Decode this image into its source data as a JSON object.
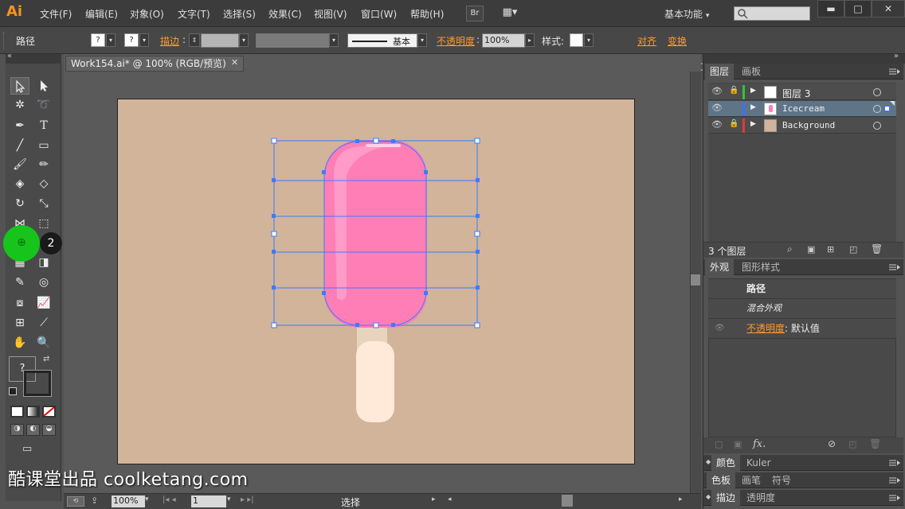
{
  "app": {
    "logo": "Ai",
    "workspace_label": "基本功能",
    "workspace_arrow": "▾"
  },
  "menu": [
    {
      "label": "文件(F)"
    },
    {
      "label": "编辑(E)"
    },
    {
      "label": "对象(O)"
    },
    {
      "label": "文字(T)"
    },
    {
      "label": "选择(S)"
    },
    {
      "label": "效果(C)"
    },
    {
      "label": "视图(V)"
    },
    {
      "label": "窗口(W)"
    },
    {
      "label": "帮助(H)"
    }
  ],
  "menu_buttons": {
    "bridge": "Br",
    "arrange": "▦▾"
  },
  "window_buttons": {
    "minimize": "▬",
    "maximize": "□",
    "close": "✕"
  },
  "control_bar": {
    "object_type": "路径",
    "fill_unknown": "?",
    "stroke_unknown": "?",
    "stroke_label": "描边",
    "stroke_style": "基本",
    "opacity_label": "不透明度",
    "opacity_value": "100%",
    "style_label": "样式",
    "align_label": "对齐",
    "transform_label": "变换"
  },
  "document": {
    "tab_title": "Work154.ai* @ 100% (RGB/预览)",
    "tab_close": "✕"
  },
  "toolbar": {
    "fill_stroke_unknown": "?"
  },
  "status_bar": {
    "zoom": "100%",
    "artboard": "1",
    "status_text": "选择"
  },
  "layers_panel": {
    "tabs": [
      {
        "label": "图层"
      },
      {
        "label": "画板"
      }
    ],
    "layers": [
      {
        "name": "图层 3",
        "color": "#2fc43a",
        "locked": true
      },
      {
        "name": "Icecream",
        "color": "#3d6fff",
        "locked": false
      },
      {
        "name": "Background",
        "color": "#e23a3a",
        "locked": true
      }
    ],
    "count_label": "3 个图层"
  },
  "appearance_panel": {
    "tabs": [
      {
        "label": "外观"
      },
      {
        "label": "图形样式"
      }
    ],
    "title": "路径",
    "mixed": "混合外观",
    "opacity_label": "不透明度",
    "opacity_value": "默认值",
    "fx_label": "fx."
  },
  "bottom_panels": {
    "row1": [
      {
        "label": "颜色"
      },
      {
        "label": "Kuler"
      }
    ],
    "row2": [
      {
        "label": "色板"
      },
      {
        "label": "画笔"
      },
      {
        "label": "符号"
      }
    ],
    "row3": [
      {
        "label": "描边"
      },
      {
        "label": "透明度"
      }
    ]
  },
  "overlay": {
    "step_number": "2"
  },
  "watermark": "酷课堂出品 coolketang.com",
  "colors": {
    "artboard": "#d1b49a",
    "icecream_pink": "#ff7eb6",
    "stick": "#ffe9d8",
    "selection_blue": "#3b7cff",
    "highlight_green": "#17c41b"
  }
}
